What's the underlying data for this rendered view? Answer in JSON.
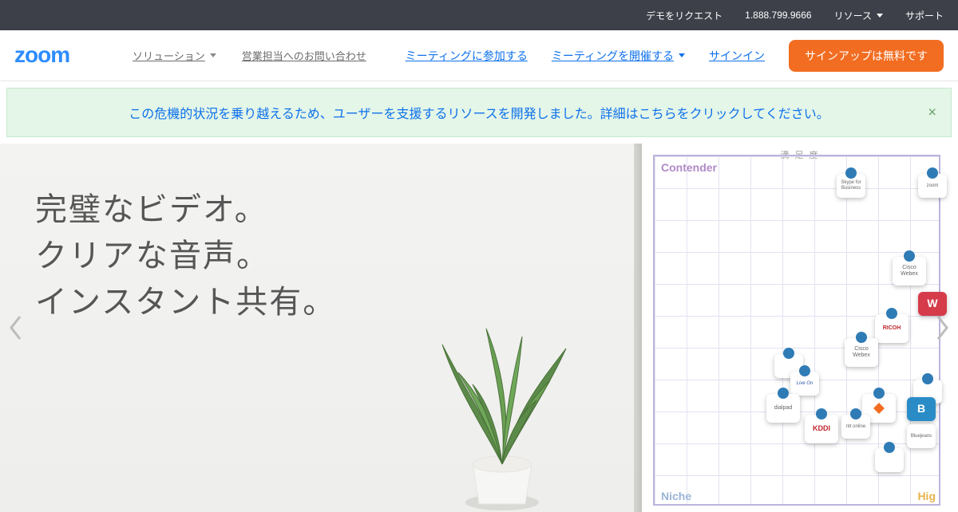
{
  "topbar": {
    "demo": "デモをリクエスト",
    "phone": "1.888.799.9666",
    "resources": "リソース",
    "support": "サポート"
  },
  "header": {
    "logo_text": "zoom",
    "nav_left": {
      "solutions": "ソリューション",
      "contact_sales": "営業担当へのお問い合わせ"
    },
    "nav_right": {
      "join_meeting": "ミーティングに参加する",
      "host_meeting": "ミーティングを開催する",
      "sign_in": "サインイン",
      "sign_up": "サインアップは無料です"
    }
  },
  "banner": {
    "text": "この危機的状況を乗り越えるため、ユーザーを支援するリソースを開発しました。詳細はこちらをクリックしてください。",
    "close": "×"
  },
  "hero": {
    "line1": "完璧なビデオ。",
    "line2": "クリアな音声。",
    "line3": "インスタント共有。"
  },
  "quadrant": {
    "axis_top": "満 足 度",
    "contender": "Contender",
    "niche": "Niche",
    "high": "Hig",
    "chips": {
      "skype": "Skype for Business",
      "zoom": "zoom",
      "cisco1": "Cisco Webex",
      "ricoh": "RICOH",
      "cisco2": "Cisco Webex",
      "w": "W",
      "liveon": "Live On",
      "dialpad": "dialpad",
      "kddi": "KDDI",
      "ntt": "ntt online",
      "b": "B",
      "bluejeans": "Bluejeans",
      "blank1": "",
      "blank2": ""
    }
  }
}
